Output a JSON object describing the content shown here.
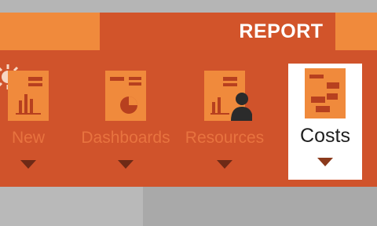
{
  "tabs": {
    "active_label": "REPORT"
  },
  "ribbon": {
    "items": [
      {
        "label": "New",
        "icon": "bar-chart-icon"
      },
      {
        "label": "Dashboards",
        "icon": "pie-chart-icon"
      },
      {
        "label": "Resources",
        "icon": "chart-person-icon"
      },
      {
        "label": "Costs",
        "icon": "cost-sheet-icon",
        "selected": true
      }
    ]
  },
  "colors": {
    "ribbon": "#d0532b",
    "tab_light": "#f08a3c",
    "tab_dark": "#d2542a",
    "icon_fill": "#f08a3c",
    "icon_dark": "#b7401f",
    "selected_bg": "#ffffff"
  }
}
